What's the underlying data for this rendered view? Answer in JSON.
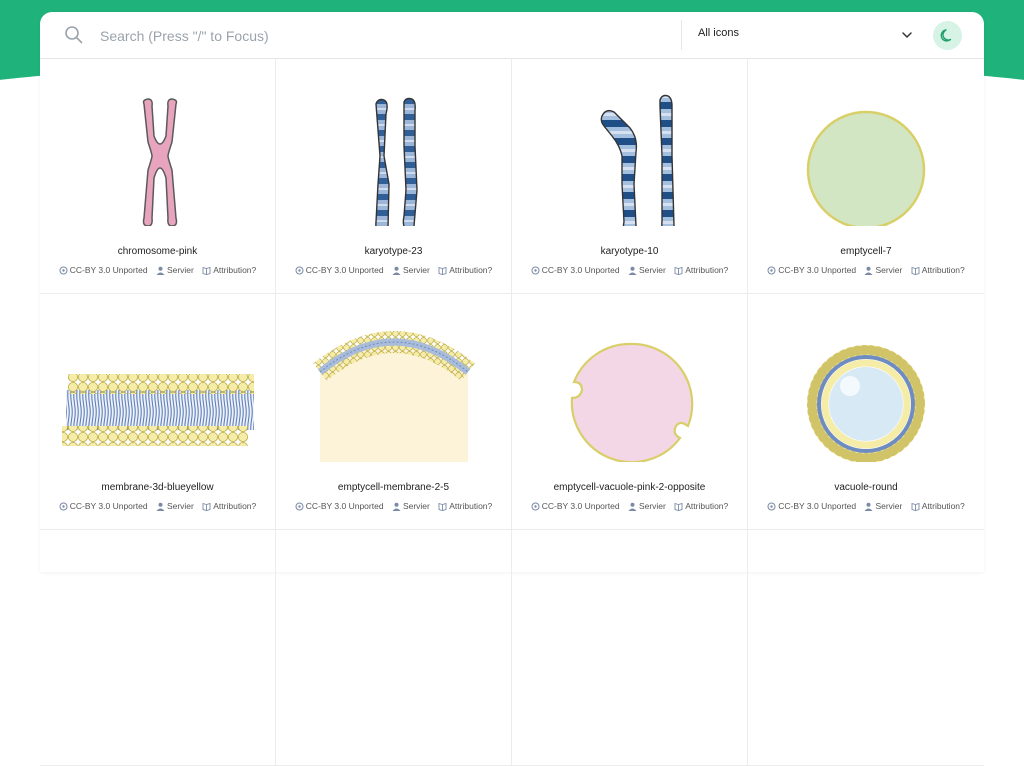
{
  "search": {
    "placeholder": "Search (Press \"/\" to Focus)",
    "value": ""
  },
  "filter": {
    "selected": "All icons"
  },
  "theme_toggle": {
    "icon": "moon-icon"
  },
  "colors": {
    "accent": "#1fb27a"
  },
  "icons": [
    {
      "name": "chromosome-pink",
      "license": "CC-BY 3.0 Unported",
      "author": "Servier",
      "attribution": "Attribution?"
    },
    {
      "name": "karyotype-23",
      "license": "CC-BY 3.0 Unported",
      "author": "Servier",
      "attribution": "Attribution?"
    },
    {
      "name": "karyotype-10",
      "license": "CC-BY 3.0 Unported",
      "author": "Servier",
      "attribution": "Attribution?"
    },
    {
      "name": "emptycell-7",
      "license": "CC-BY 3.0 Unported",
      "author": "Servier",
      "attribution": "Attribution?"
    },
    {
      "name": "membrane-3d-blueyellow",
      "license": "CC-BY 3.0 Unported",
      "author": "Servier",
      "attribution": "Attribution?"
    },
    {
      "name": "emptycell-membrane-2-5",
      "license": "CC-BY 3.0 Unported",
      "author": "Servier",
      "attribution": "Attribution?"
    },
    {
      "name": "emptycell-vacuole-pink-2-opposite",
      "license": "CC-BY 3.0 Unported",
      "author": "Servier",
      "attribution": "Attribution?"
    },
    {
      "name": "vacuole-round",
      "license": "CC-BY 3.0 Unported",
      "author": "Servier",
      "attribution": "Attribution?"
    }
  ]
}
